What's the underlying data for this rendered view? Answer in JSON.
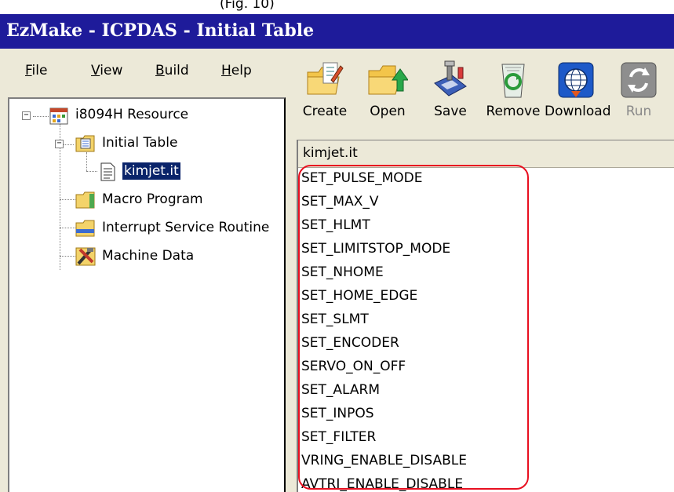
{
  "window": {
    "title": "EzMake - ICPDAS - Initial Table",
    "caption_fragment": "(Fig. 10)"
  },
  "menu": [
    {
      "label": "File",
      "accel": "F",
      "rest": "ile"
    },
    {
      "label": "View",
      "accel": "V",
      "rest": "iew"
    },
    {
      "label": "Build",
      "accel": "B",
      "rest": "uild"
    },
    {
      "label": "Help",
      "accel": "H",
      "rest": "elp"
    }
  ],
  "toolbar": {
    "buttons": [
      {
        "label": "Create",
        "icon": "create-folder-icon",
        "enabled": true
      },
      {
        "label": "Open",
        "icon": "open-folder-icon",
        "enabled": true
      },
      {
        "label": "Save",
        "icon": "save-disk-icon",
        "enabled": true
      },
      {
        "label": "Remove",
        "icon": "recycle-bin-icon",
        "enabled": true
      },
      {
        "label": "Download",
        "icon": "globe-download-icon",
        "enabled": true
      },
      {
        "label": "Run",
        "icon": "run-refresh-icon",
        "enabled": false
      }
    ]
  },
  "tree": {
    "root": {
      "label": "i8094H Resource",
      "icon": "resource-calendar-icon",
      "expander": "−"
    },
    "initial_table": {
      "label": "Initial Table",
      "icon": "table-folder-icon",
      "expander": "−"
    },
    "kimjet": {
      "label": "kimjet.it",
      "icon": "document-icon",
      "selected": true
    },
    "macro_program": {
      "label": "Macro Program",
      "icon": "folder-icon"
    },
    "isr": {
      "label": "Interrupt Service Routine",
      "icon": "folder-blue-icon"
    },
    "machine_data": {
      "label": "Machine Data",
      "icon": "tools-icon"
    }
  },
  "editor": {
    "file_name": "kimjet.it",
    "commands": [
      "SET_PULSE_MODE",
      "SET_MAX_V",
      "SET_HLMT",
      "SET_LIMITSTOP_MODE",
      "SET_NHOME",
      "SET_HOME_EDGE",
      "SET_SLMT",
      "SET_ENCODER",
      "SERVO_ON_OFF",
      "SET_ALARM",
      "SET_INPOS",
      "SET_FILTER",
      "VRING_ENABLE_DISABLE",
      "AVTRI_ENABLE_DISABLE"
    ]
  },
  "colors": {
    "titlebar": "#1e1b9a",
    "selection": "#0a246a",
    "highlight_box": "#e81020",
    "chrome": "#ece9d8"
  }
}
